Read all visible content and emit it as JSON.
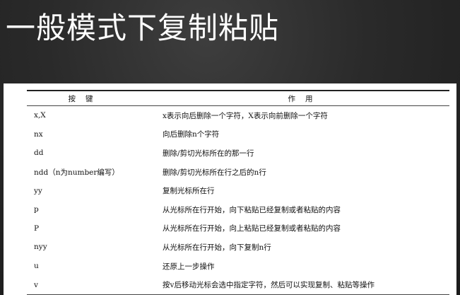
{
  "slide": {
    "title": "一般模式下复制粘贴"
  },
  "table": {
    "headers": {
      "key": "按键",
      "action": "作用"
    },
    "rows": [
      {
        "key": "x,X",
        "action": "x表示向后删除一个字符，X表示向前删除一个字符"
      },
      {
        "key": "nx",
        "action": "向后删除n个字符"
      },
      {
        "key": "dd",
        "action": "删除/剪切光标所在的那一行"
      },
      {
        "key": "ndd（n为number编写）",
        "action": "删除/剪切光标所在行之后的n行"
      },
      {
        "key": "yy",
        "action": "复制光标所在行"
      },
      {
        "key": "p",
        "action": "从光标所在行开始，向下粘贴已经复制或者粘贴的内容"
      },
      {
        "key": "P",
        "action": "从光标所在行开始，向上粘贴已经复制或者粘贴的内容"
      },
      {
        "key": "nyy",
        "action": "从光标所在行开始，向下复制n行"
      },
      {
        "key": "u",
        "action": "还原上一步操作"
      },
      {
        "key": "v",
        "action": "按v后移动光标会选中指定字符，然后可以实现复制、粘贴等操作"
      }
    ]
  },
  "colors": {
    "background": "#2a2a2a",
    "title_text": "#ffffff",
    "table_background": "#ffffff",
    "table_text": "#111111"
  }
}
